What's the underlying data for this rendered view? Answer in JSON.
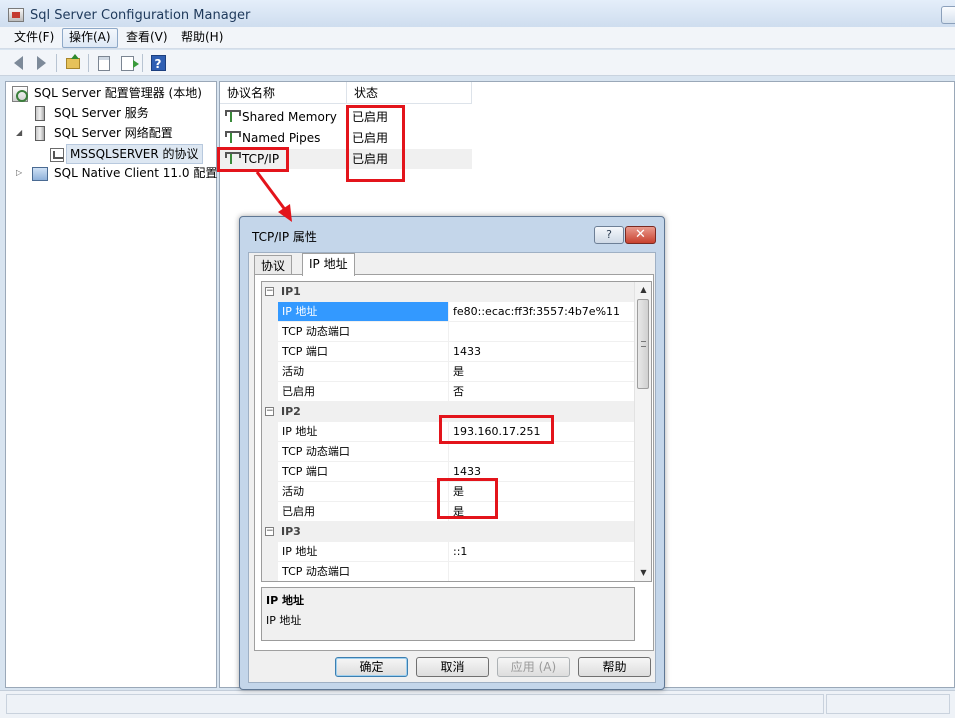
{
  "window": {
    "title": "Sql Server Configuration Manager",
    "icon": "app-icon"
  },
  "menu": [
    {
      "label": "文件(F)",
      "active": false
    },
    {
      "label": "操作(A)",
      "active": true
    },
    {
      "label": "查看(V)",
      "active": false
    },
    {
      "label": "帮助(H)",
      "active": false
    }
  ],
  "toolbar": {
    "buttons": [
      "back-arrow-icon",
      "forward-arrow-icon",
      "up-folder-icon",
      "properties-icon",
      "export-list-icon",
      "help-icon"
    ],
    "help_glyph": "?"
  },
  "tree": {
    "root": "SQL Server 配置管理器 (本地)",
    "items": [
      {
        "label": "SQL Server 服务",
        "expander": ""
      },
      {
        "label": "SQL Server 网络配置",
        "expander": "◢"
      },
      {
        "label": "MSSQLSERVER 的协议",
        "expander": "",
        "selected": true
      },
      {
        "label": "SQL Native Client 11.0 配置",
        "expander": "▷"
      }
    ]
  },
  "list": {
    "columns": [
      "协议名称",
      "状态"
    ],
    "rows": [
      {
        "name": "Shared Memory",
        "status": "已启用"
      },
      {
        "name": "Named Pipes",
        "status": "已启用"
      },
      {
        "name": "TCP/IP",
        "status": "已启用",
        "selected": true
      }
    ]
  },
  "dialog": {
    "title": "TCP/IP 属性",
    "help_glyph": "?",
    "close_glyph": "✕",
    "tabs": [
      {
        "label": "协议",
        "active": false
      },
      {
        "label": "IP 地址",
        "active": true
      }
    ],
    "grid": {
      "groups": [
        {
          "name": "IP1",
          "toggle": "⊟",
          "rows": [
            {
              "name": "IP 地址",
              "value": "fe80::ecac:ff3f:3557:4b7e%11",
              "selected": true
            },
            {
              "name": "TCP 动态端口",
              "value": ""
            },
            {
              "name": "TCP 端口",
              "value": "1433"
            },
            {
              "name": "活动",
              "value": "是"
            },
            {
              "name": "已启用",
              "value": "否"
            }
          ]
        },
        {
          "name": "IP2",
          "toggle": "⊟",
          "rows": [
            {
              "name": "IP 地址",
              "value": "193.160.17.251"
            },
            {
              "name": "TCP 动态端口",
              "value": ""
            },
            {
              "name": "TCP 端口",
              "value": "1433"
            },
            {
              "name": "活动",
              "value": "是"
            },
            {
              "name": "已启用",
              "value": "是"
            }
          ]
        },
        {
          "name": "IP3",
          "toggle": "⊟",
          "rows": [
            {
              "name": "IP 地址",
              "value": "::1"
            },
            {
              "name": "TCP 动态端口",
              "value": ""
            }
          ]
        }
      ],
      "scroll_up": "▲",
      "scroll_down": "▼"
    },
    "description": {
      "title": "IP 地址",
      "text": "IP 地址"
    },
    "buttons": {
      "ok": "确定",
      "cancel": "取消",
      "apply": "应用 (A)",
      "help": "帮助"
    }
  },
  "annotations": {
    "color": "#e3141b"
  }
}
